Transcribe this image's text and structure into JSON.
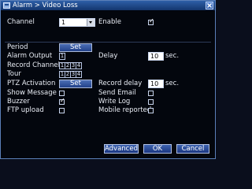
{
  "window": {
    "title": "Alarm > Video Loss"
  },
  "channel": {
    "label": "Channel",
    "value": "1",
    "enable_label": "Enable",
    "enable_checked": true
  },
  "period": {
    "label": "Period",
    "button": "Set"
  },
  "alarm_output": {
    "label": "Alarm Output",
    "boxes": [
      "1"
    ]
  },
  "delay": {
    "label": "Delay",
    "value": "10",
    "unit": "sec."
  },
  "record_channel": {
    "label": "Record Channel",
    "boxes": [
      "1",
      "2",
      "3",
      "4"
    ]
  },
  "tour": {
    "label": "Tour",
    "boxes": [
      "1",
      "2",
      "3",
      "4"
    ]
  },
  "ptz_activation": {
    "label": "PTZ Activation",
    "button": "Set"
  },
  "record_delay": {
    "label": "Record delay",
    "value": "10",
    "unit": "sec."
  },
  "show_message": {
    "label": "Show Message",
    "checked": false
  },
  "send_email": {
    "label": "Send Email",
    "checked": false
  },
  "buzzer": {
    "label": "Buzzer",
    "checked": true
  },
  "write_log": {
    "label": "Write Log",
    "checked": false
  },
  "ftp_upload": {
    "label": "FTP upload",
    "checked": false
  },
  "mobile_reported": {
    "label": "Mobile reported",
    "checked": false
  },
  "footer": {
    "advanced": "Advanced",
    "ok": "OK",
    "cancel": "Cancel"
  }
}
